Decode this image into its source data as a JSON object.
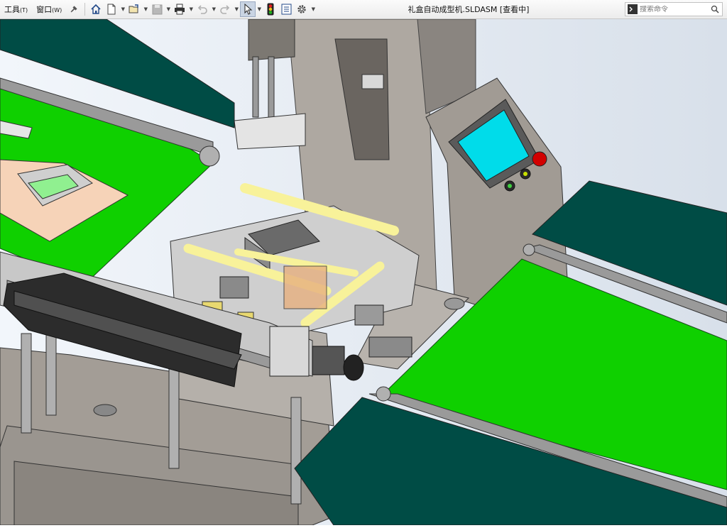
{
  "menu": {
    "tools": "工具",
    "tools_key": "(T)",
    "window": "窗口",
    "window_key": "(W)"
  },
  "document": {
    "title": "礼盒自动成型机.SLDASM [查看中]"
  },
  "search": {
    "placeholder": "搜索命令"
  },
  "icons": [
    "pin-icon",
    "home-icon",
    "new-file-icon",
    "open-file-icon",
    "save-icon",
    "print-icon",
    "undo-icon",
    "redo-icon",
    "select-pointer-icon",
    "traffic-light-icon",
    "file-properties-icon",
    "options-gear-icon",
    "command-prompt-icon",
    "search-icon"
  ],
  "colors": {
    "conveyor_belt": "#0fd000",
    "conveyor_frame": "#004c45",
    "machine_body": "#b3aea7",
    "hmi_screen": "#00dcea",
    "emergency_stop": "#d20000",
    "guide_rods": "#f8f29a",
    "box_blank": "#f6d3b8",
    "toolbar_bg": "#f0f0f0"
  }
}
